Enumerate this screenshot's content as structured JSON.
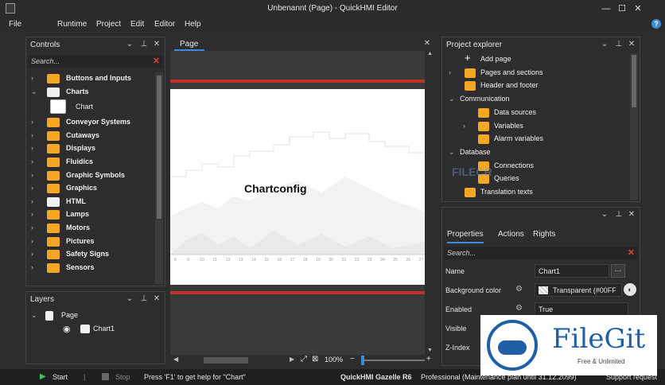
{
  "window": {
    "title": "Unbenannt (Page) - QuickHMI Editor"
  },
  "menu": [
    "File",
    "Runtime",
    "Project",
    "Edit",
    "Editor",
    "Help"
  ],
  "controls": {
    "title": "Controls",
    "search_placeholder": "Search...",
    "items": [
      {
        "label": "Buttons and Inputs",
        "icon": "buttons-icon",
        "color": "#f5a623",
        "expanded": false
      },
      {
        "label": "Charts",
        "icon": "charts-icon",
        "color": "#f0f0f0",
        "expanded": true
      },
      {
        "label": "Chart",
        "icon": "chart-item-icon",
        "color": "#ffffff",
        "child": true
      },
      {
        "label": "Conveyor Systems",
        "icon": "conveyor-icon",
        "color": "#f5a623"
      },
      {
        "label": "Cutaways",
        "icon": "cutaways-icon",
        "color": "#f5a623"
      },
      {
        "label": "Displays",
        "icon": "displays-icon",
        "color": "#f5a623"
      },
      {
        "label": "Fluidics",
        "icon": "fluidics-icon",
        "color": "#f5a623"
      },
      {
        "label": "Graphic Symbols",
        "icon": "graphic-symbols-icon",
        "color": "#f5a623"
      },
      {
        "label": "Graphics",
        "icon": "graphics-icon",
        "color": "#f5a623"
      },
      {
        "label": "HTML",
        "icon": "html-icon",
        "color": "#f0f0f0"
      },
      {
        "label": "Lamps",
        "icon": "lamps-icon",
        "color": "#f5a623"
      },
      {
        "label": "Motors",
        "icon": "motors-icon",
        "color": "#f5a623"
      },
      {
        "label": "Pictures",
        "icon": "pictures-icon",
        "color": "#f5a623"
      },
      {
        "label": "Safety Signs",
        "icon": "safety-signs-icon",
        "color": "#f5a623"
      },
      {
        "label": "Sensors",
        "icon": "sensors-icon",
        "color": "#f5a623"
      }
    ]
  },
  "layers": {
    "title": "Layers",
    "page_label": "Page",
    "chart_label": "Chart1"
  },
  "document": {
    "tab": "Page",
    "chart_title": "Chartconfig",
    "x_ticks": [
      "8",
      "9",
      "10",
      "11",
      "12",
      "13",
      "14",
      "15",
      "16",
      "17",
      "18",
      "19",
      "20",
      "21",
      "22",
      "23",
      "24",
      "25",
      "26",
      "27"
    ],
    "zoom": "100%"
  },
  "project_explorer": {
    "title": "Project explorer",
    "items": [
      {
        "label": "Add page",
        "level": 1,
        "arrow": ""
      },
      {
        "label": "Pages and sections",
        "level": 1,
        "arrow": "›"
      },
      {
        "label": "Header and footer",
        "level": 1,
        "arrow": ""
      },
      {
        "label": "Communication",
        "level": 0,
        "arrow": "⌄"
      },
      {
        "label": "Data sources",
        "level": 2,
        "arrow": ""
      },
      {
        "label": "Variables",
        "level": 2,
        "arrow": "›"
      },
      {
        "label": "Alarm variables",
        "level": 2,
        "arrow": ""
      },
      {
        "label": "Database",
        "level": 0,
        "arrow": "⌄"
      },
      {
        "label": "Connections",
        "level": 2,
        "arrow": ""
      },
      {
        "label": "Queries",
        "level": 2,
        "arrow": ""
      },
      {
        "label": "Translation texts",
        "level": 1,
        "arrow": ""
      }
    ]
  },
  "properties": {
    "tabs": [
      "Properties",
      "Actions",
      "Rights"
    ],
    "search_placeholder": "Search...",
    "rows": [
      {
        "name": "Name",
        "value": "Chart1"
      },
      {
        "name": "Background color",
        "value": "Transparent (#00FF"
      },
      {
        "name": "Enabled",
        "value": "True"
      },
      {
        "name": "Visible",
        "value": ""
      },
      {
        "name": "Z-Index",
        "value": ""
      }
    ]
  },
  "status": {
    "start": "Start",
    "stop": "Stop",
    "help": "Press 'F1' to get help for \"Chart\"",
    "product": "QuickHMI Gazelle R6",
    "license": "Professional (Maintenance plan until 31.12.2099)",
    "support": "Support request"
  },
  "watermark": {
    "brand": "FileGit",
    "tagline": "Free & Unlimited",
    "overlay": "FILECR"
  },
  "colors": {
    "accent": "#3c8bd9",
    "red_guide": "#c0312b",
    "icon_orange": "#f5a623"
  }
}
